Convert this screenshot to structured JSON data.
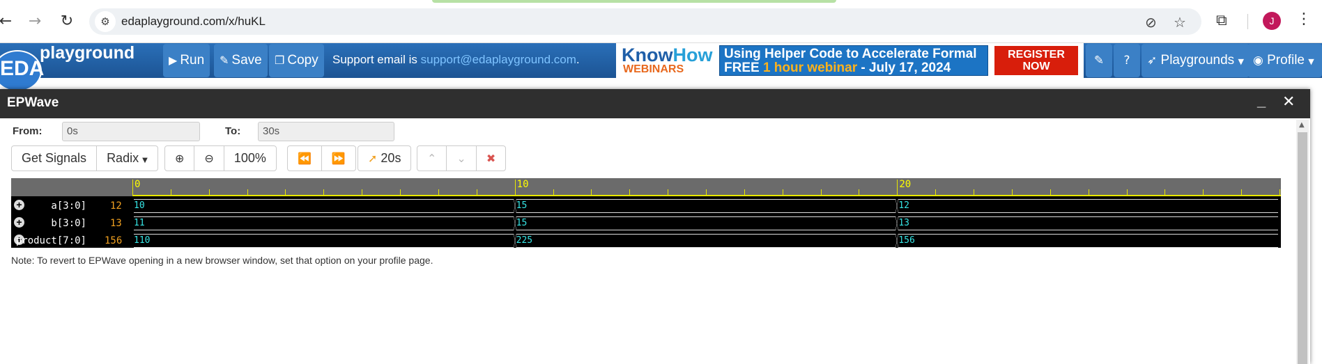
{
  "browser": {
    "url": "edaplayground.com/x/huKL",
    "avatar_letter": "J",
    "icons": [
      "back-icon",
      "forward-icon",
      "reload-icon",
      "site-info-icon",
      "eye-off-icon",
      "star-icon",
      "extensions-icon",
      "kebab-menu-icon"
    ]
  },
  "toolbar": {
    "logo_eda": "EDA",
    "logo_playground": "playground",
    "run_label": "Run",
    "save_label": "Save",
    "copy_label": "Copy",
    "support_text": "Support email is ",
    "support_email": "support@edaplayground.com",
    "support_end": ".",
    "playgrounds_label": "Playgrounds",
    "profile_label": "Profile"
  },
  "banner": {
    "brand_a": "Know",
    "brand_b": "How",
    "webinars": "WEBINARS",
    "line1": "Using Helper Code to Accelerate Formal",
    "line2_a": "FREE ",
    "line2_b": "1 hour webinar",
    "line2_c": " - July 17, 2024",
    "register_1": "REGISTER",
    "register_2": "NOW"
  },
  "epwave": {
    "title": "EPWave",
    "from_label": "From:",
    "from_value": "0s",
    "to_label": "To:",
    "to_value": "30s",
    "get_signals": "Get Signals",
    "radix": "Radix",
    "zoom_level": "100%",
    "cursor_time": "20s",
    "note": "Note: To revert to EPWave opening in a new browser window, set that option on your profile page."
  },
  "waveform": {
    "time_max": 30,
    "major_ticks": [
      {
        "t": 0,
        "label": "0"
      },
      {
        "t": 10,
        "label": "10"
      },
      {
        "t": 20,
        "label": "20"
      }
    ],
    "signals": [
      {
        "name": "a[3:0]",
        "cursor_value": "12",
        "segments": [
          {
            "start": 0,
            "end": 10,
            "value": "10"
          },
          {
            "start": 10,
            "end": 20,
            "value": "15"
          },
          {
            "start": 20,
            "end": 30,
            "value": "12"
          }
        ]
      },
      {
        "name": "b[3:0]",
        "cursor_value": "13",
        "segments": [
          {
            "start": 0,
            "end": 10,
            "value": "11"
          },
          {
            "start": 10,
            "end": 20,
            "value": "15"
          },
          {
            "start": 20,
            "end": 30,
            "value": "13"
          }
        ]
      },
      {
        "name": "product[7:0]",
        "cursor_value": "156",
        "segments": [
          {
            "start": 0,
            "end": 10,
            "value": "110"
          },
          {
            "start": 10,
            "end": 20,
            "value": "225"
          },
          {
            "start": 20,
            "end": 30,
            "value": "156"
          }
        ]
      }
    ],
    "colors": {
      "value_text": "#36e6e6",
      "ruler_text": "#ffff00",
      "cursor_value": "#f0a020"
    }
  }
}
